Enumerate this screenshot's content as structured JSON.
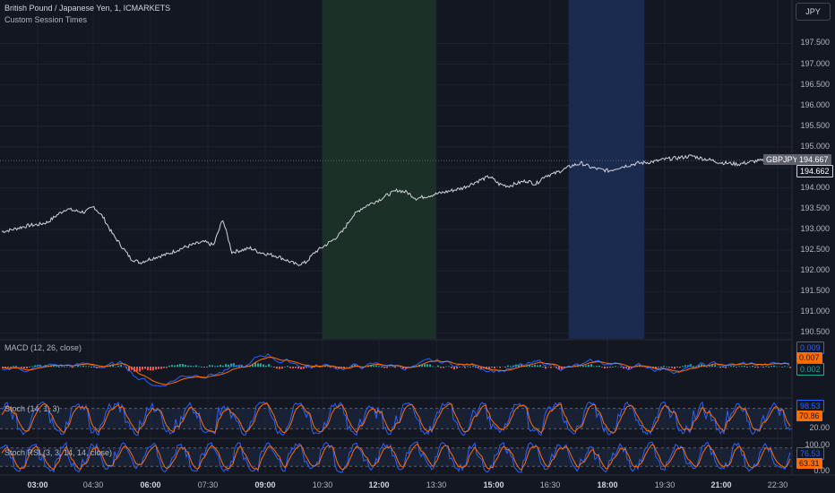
{
  "header": {
    "symbol_title": "British Pound / Japanese Yen, 1, ICMARKETS",
    "indicator_name": "Custom Session Times",
    "currency_button": "JPY"
  },
  "colors": {
    "background": "#131722",
    "grid": "#1e222d",
    "price_line": "#d1d4dc",
    "session_green": "#1b3026",
    "session_blue": "#1b2a4f",
    "macd_line": "#2962ff",
    "signal_line": "#ff6d00",
    "hist_pos": "#26a69a",
    "hist_neg": "#ef5350",
    "stoch_k": "#2962ff",
    "stoch_d": "#ff6d00"
  },
  "price_axis": {
    "ticks": [
      "197.500",
      "197.000",
      "196.500",
      "196.000",
      "195.500",
      "195.000",
      "194.500",
      "194.000",
      "193.500",
      "193.000",
      "192.500",
      "192.000",
      "191.500",
      "191.000",
      "190.500"
    ],
    "symbol_label": "GBPJPY",
    "symbol_price": "194.667",
    "current_price": "194.662"
  },
  "time_axis": {
    "labels": [
      {
        "text": "03:00",
        "major": true
      },
      {
        "text": "04:30",
        "major": false
      },
      {
        "text": "06:00",
        "major": true
      },
      {
        "text": "07:30",
        "major": false
      },
      {
        "text": "09:00",
        "major": true
      },
      {
        "text": "10:30",
        "major": false
      },
      {
        "text": "12:00",
        "major": true
      },
      {
        "text": "13:30",
        "major": false
      },
      {
        "text": "15:00",
        "major": true
      },
      {
        "text": "16:30",
        "major": false
      },
      {
        "text": "18:00",
        "major": true
      },
      {
        "text": "19:30",
        "major": false
      },
      {
        "text": "21:00",
        "major": true
      },
      {
        "text": "22:30",
        "major": false
      }
    ]
  },
  "macd": {
    "label": "MACD (12, 26, close)",
    "values": [
      {
        "text": "0.009",
        "color": "#2962ff"
      },
      {
        "text": "0.007",
        "color": "#ff6d00"
      },
      {
        "text": "0.002",
        "color": "#26a69a"
      }
    ]
  },
  "stoch": {
    "label": "Stoch (14, 1, 3)",
    "values": [
      {
        "text": "98.53",
        "color": "#2962ff"
      },
      {
        "text": "70.86",
        "color": "#ff6d00"
      }
    ],
    "ticks": [
      "80.00",
      "20.00"
    ]
  },
  "stoch_rsi": {
    "label": "Stoch RSI (3, 3, 14, 14, close)",
    "values": [
      {
        "text": "76.53",
        "color": "#2962ff"
      },
      {
        "text": "63.31",
        "color": "#ff6d00"
      }
    ],
    "ticks": [
      "100.00",
      "0.00"
    ]
  },
  "chart_data": {
    "type": "line",
    "series": [
      {
        "values": [
          192.95,
          192.99,
          193.05,
          193.1,
          193.12,
          193.18,
          193.35,
          193.5,
          193.45,
          193.42,
          193.55,
          193.3,
          192.9,
          192.6,
          192.3,
          192.2,
          192.28,
          192.35,
          192.4,
          192.5,
          192.58,
          192.65,
          192.7,
          192.62,
          193.25,
          192.45,
          192.5,
          192.55,
          192.45,
          192.4,
          192.35,
          192.25,
          192.15,
          192.2,
          192.45,
          192.6,
          192.75,
          192.95,
          193.3,
          193.5,
          193.62,
          193.72,
          193.85,
          193.95,
          193.9,
          193.75,
          193.8,
          193.85,
          193.9,
          193.95,
          194.0,
          194.1,
          194.2,
          194.28,
          194.1,
          194.05,
          194.12,
          194.18,
          194.1,
          194.3,
          194.35,
          194.45,
          194.55,
          194.6,
          194.5,
          194.45,
          194.42,
          194.5,
          194.55,
          194.6,
          194.62,
          194.65,
          194.7,
          194.72,
          194.75,
          194.78,
          194.72,
          194.68,
          194.62,
          194.6,
          194.58,
          194.62,
          194.66,
          194.662
        ]
      }
    ],
    "y_range": [
      190.4,
      197.9
    ],
    "session_shading": [
      {
        "from": "10:30",
        "to": "13:30",
        "color": "green"
      },
      {
        "from": "17:00",
        "to": "19:00",
        "color": "blue"
      }
    ],
    "grid": true
  }
}
